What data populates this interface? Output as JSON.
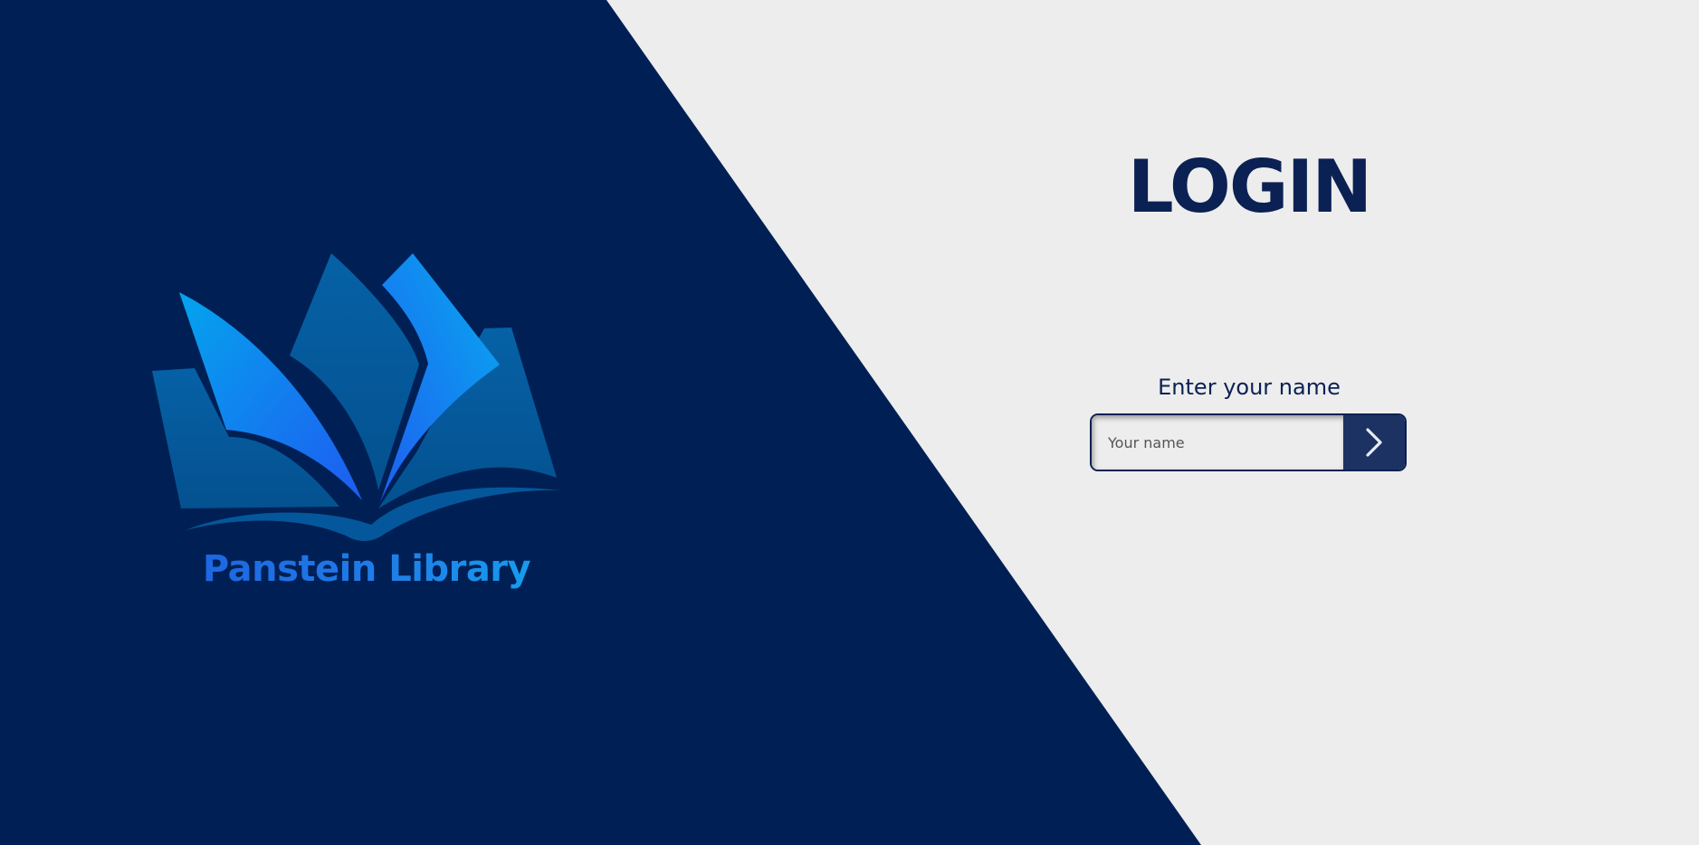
{
  "brand": {
    "name": "Panstein Library",
    "logo_icon": "open-book-icon"
  },
  "login": {
    "title": "LOGIN",
    "label": "Enter your name",
    "input_placeholder": "Your name",
    "input_value": "",
    "submit_icon": "chevron-right-icon"
  },
  "colors": {
    "navy": "#002055",
    "light_bg": "#ededed",
    "title_text": "#0b2154",
    "button_bg": "#1c3263",
    "logo_blue": "#1d5fe0",
    "logo_cyan": "#12a8ef"
  }
}
